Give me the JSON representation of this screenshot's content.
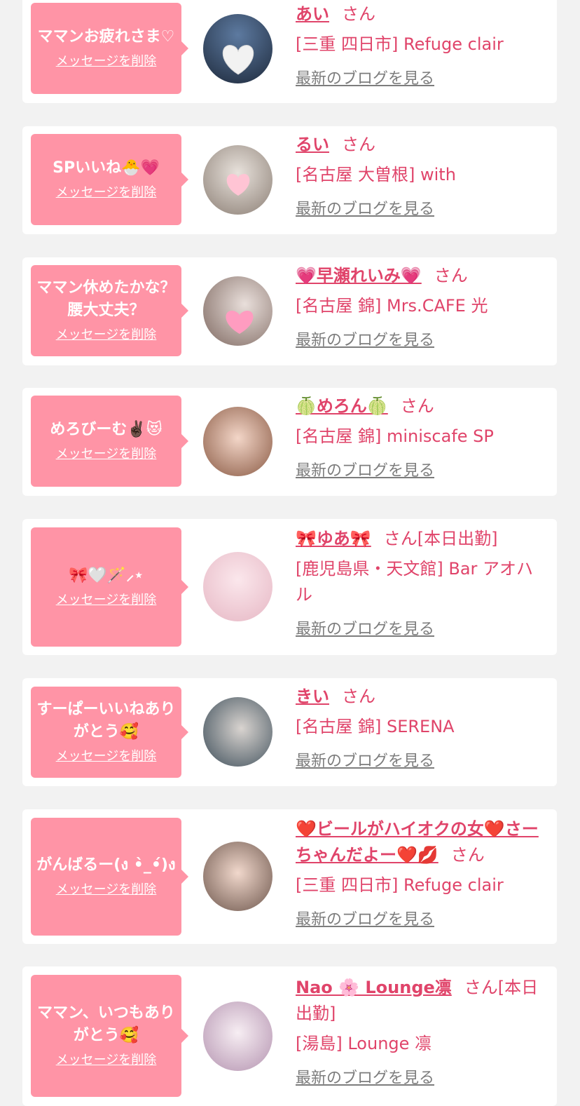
{
  "delete_label": "メッセージを削除",
  "blog_label": "最新のブログを見る",
  "honorific": "さん",
  "colors": {
    "bubble": "#ff94a6",
    "name": "#e0446a",
    "link": "#7d7d7d",
    "card": "#ffffff",
    "background": "#f2f2f2"
  },
  "items": [
    {
      "message": "ママンお疲れさま♡",
      "name": "あい",
      "status": "",
      "shop": "[三重 四日市] Refuge clair",
      "avatar_bg": "#2c3e57"
    },
    {
      "message": "SPいいね🐣💗",
      "name": "るい",
      "status": "",
      "shop": "[名古屋 大曽根] with",
      "avatar_bg": "#b9ada3"
    },
    {
      "message": "ママン休めたかな？腰大丈夫？",
      "name": "💗早瀬れいみ💗",
      "status": "",
      "shop": "[名古屋 錦] Mrs.CAFE 光",
      "avatar_bg": "#b6a49a"
    },
    {
      "message": "めろびーむ✌🏿😻",
      "name": "🍈めろん🍈",
      "status": "",
      "shop": "[名古屋 錦] miniscafe SP",
      "avatar_bg": "#c58f78"
    },
    {
      "message": "🎀🤍🪄⸝⋆",
      "name": "🎀ゆあ🎀",
      "status": "[本日出勤]",
      "shop": "[鹿児島県・天文館] Bar アオハル",
      "avatar_bg": "#f1cbd4"
    },
    {
      "message": "すーぱーいいねありがとう🥰",
      "name": "きい",
      "status": "",
      "shop": "[名古屋 錦] SERENA",
      "avatar_bg": "#5a6e7c"
    },
    {
      "message": "がんばるー(ง •̀_•́)ง",
      "name": "❤️ビールがハイオクの女❤️さーちゃんだよー❤️💋",
      "status": "",
      "shop": "[三重 四日市] Refuge clair",
      "avatar_bg": "#a88a7c"
    },
    {
      "message": "ママン、いつもありがとう🥰",
      "name": "Nao 🌸 Lounge凛",
      "status": "[本日出勤]",
      "shop": "[湯島] Lounge 凛",
      "avatar_bg": "#e2d3dd"
    }
  ]
}
